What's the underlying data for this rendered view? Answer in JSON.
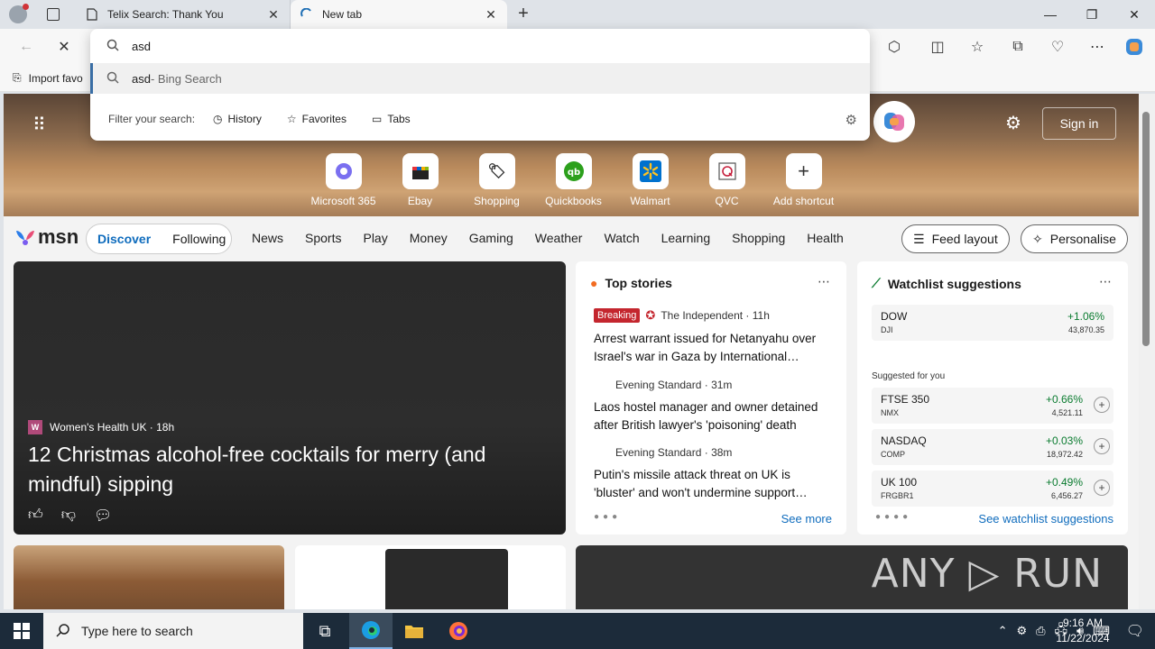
{
  "browser": {
    "tabs": [
      {
        "title": "Telix Search: Thank You",
        "icon": "page-icon"
      },
      {
        "title": "New tab",
        "icon": "loading-icon"
      }
    ],
    "favorites_bar_label": "Import favo"
  },
  "omnibox": {
    "query": "asd",
    "suggestion_query": "asd",
    "suggestion_suffix": " - Bing Search",
    "filter_label": "Filter your search:",
    "filters": [
      "History",
      "Favorites",
      "Tabs"
    ]
  },
  "hero": {
    "signin_label": "Sign in",
    "shortcuts": [
      {
        "label": "Microsoft 365",
        "icon": "m365-icon"
      },
      {
        "label": "Ebay",
        "icon": "ebay-icon"
      },
      {
        "label": "Shopping",
        "icon": "shopping-tag-icon"
      },
      {
        "label": "Quickbooks",
        "icon": "quickbooks-icon"
      },
      {
        "label": "Walmart",
        "icon": "walmart-icon"
      },
      {
        "label": "QVC",
        "icon": "qvc-icon"
      },
      {
        "label": "Add shortcut",
        "icon": "plus-icon"
      }
    ]
  },
  "nav": {
    "logo": "msn",
    "discover": "Discover",
    "following": "Following",
    "items": [
      "News",
      "Sports",
      "Play",
      "Money",
      "Gaming",
      "Weather",
      "Watch",
      "Learning",
      "Shopping",
      "Health"
    ],
    "feed_layout": "Feed layout",
    "personalise": "Personalise"
  },
  "hero_card": {
    "source": "Women's Health UK · 18h",
    "headline": "12 Christmas alcohol-free cocktails for merry (and mindful) sipping"
  },
  "top_stories": {
    "title": "Top stories",
    "stories": [
      {
        "badge": "Breaking",
        "source": "The Independent · 11h",
        "title": "Arrest warrant issued for Netanyahu over Israel's war in Gaza by International…"
      },
      {
        "source": "Evening Standard · 31m",
        "title": "Laos hostel manager and owner detained after British lawyer's 'poisoning' death"
      },
      {
        "source": "Evening Standard · 38m",
        "title": "Putin's missile attack threat on UK is 'bluster' and won't undermine support…"
      }
    ],
    "see_more": "See more"
  },
  "watchlist": {
    "title": "Watchlist suggestions",
    "top": {
      "name": "DOW",
      "symbol": "DJI",
      "change": "+1.06%",
      "price": "43,870.35"
    },
    "suggested_label": "Suggested for you",
    "stocks": [
      {
        "name": "FTSE 350",
        "symbol": "NMX",
        "change": "+0.66%",
        "price": "4,521.11"
      },
      {
        "name": "NASDAQ",
        "symbol": "COMP",
        "change": "+0.03%",
        "price": "18,972.42"
      },
      {
        "name": "UK 100",
        "symbol": "FRGBR1",
        "change": "+0.49%",
        "price": "6,456.27"
      }
    ],
    "see_link": "See watchlist suggestions",
    "positive_color": "#0a7b2f"
  },
  "watermark": "ANY ▷ RUN",
  "taskbar": {
    "search_placeholder": "Type here to search",
    "time": "9:16 AM",
    "date": "11/22/2024"
  }
}
